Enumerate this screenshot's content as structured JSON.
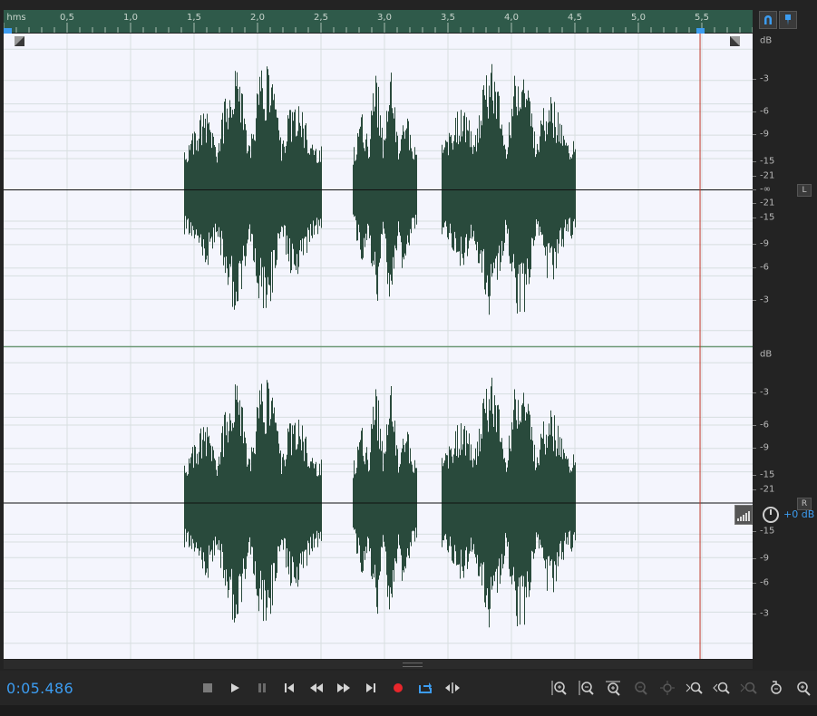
{
  "ruler": {
    "unit_label": "hms",
    "labels": [
      "0,5",
      "1,0",
      "1,5",
      "2,0",
      "2,5",
      "3,0",
      "3,5",
      "4,0",
      "4,5",
      "5,0",
      "5,5"
    ]
  },
  "scale": {
    "unit": "dB",
    "left_labels": [
      "-3",
      "-6",
      "-9",
      "-15",
      "-21",
      "-∞",
      "-21",
      "-15",
      "-9",
      "-6",
      "-3"
    ],
    "right_labels": [
      "-3",
      "-6",
      "-9",
      "-15",
      "-21",
      "-∞",
      "-15",
      "-9",
      "-6",
      "-3"
    ],
    "channel_left": "L",
    "channel_right": "R"
  },
  "playhead": {
    "time_seconds": 5.486
  },
  "gain_hud": {
    "value": "+0 dB"
  },
  "transport": {
    "time": "0:05.486",
    "buttons": [
      "stop",
      "play",
      "pause",
      "go-to-start",
      "rewind",
      "fast-forward",
      "go-to-end",
      "record",
      "loop-playback",
      "skip-selection"
    ]
  },
  "zoom_tools": [
    "zoom-in-amplitude",
    "zoom-out-amplitude",
    "zoom-in-time-full",
    "zoom-out-full",
    "zoom-selection",
    "zoom-in-left",
    "zoom-in-right",
    "zoom-out-partial",
    "zoom-reset",
    "zoom-extra"
  ],
  "colors": {
    "waveform": "#294a3c",
    "background": "#f4f5fd",
    "grid": "#d7dee0",
    "playhead": "#c0392b",
    "accent": "#3c9cf0",
    "ruler": "#2f5a4a"
  },
  "waveform": {
    "duration_seconds": 5.9,
    "segments": [
      {
        "start": 1.42,
        "end": 2.5,
        "peak": 0.82
      },
      {
        "start": 2.75,
        "end": 3.25,
        "peak": 0.78
      },
      {
        "start": 3.45,
        "end": 4.5,
        "peak": 0.86
      }
    ]
  }
}
